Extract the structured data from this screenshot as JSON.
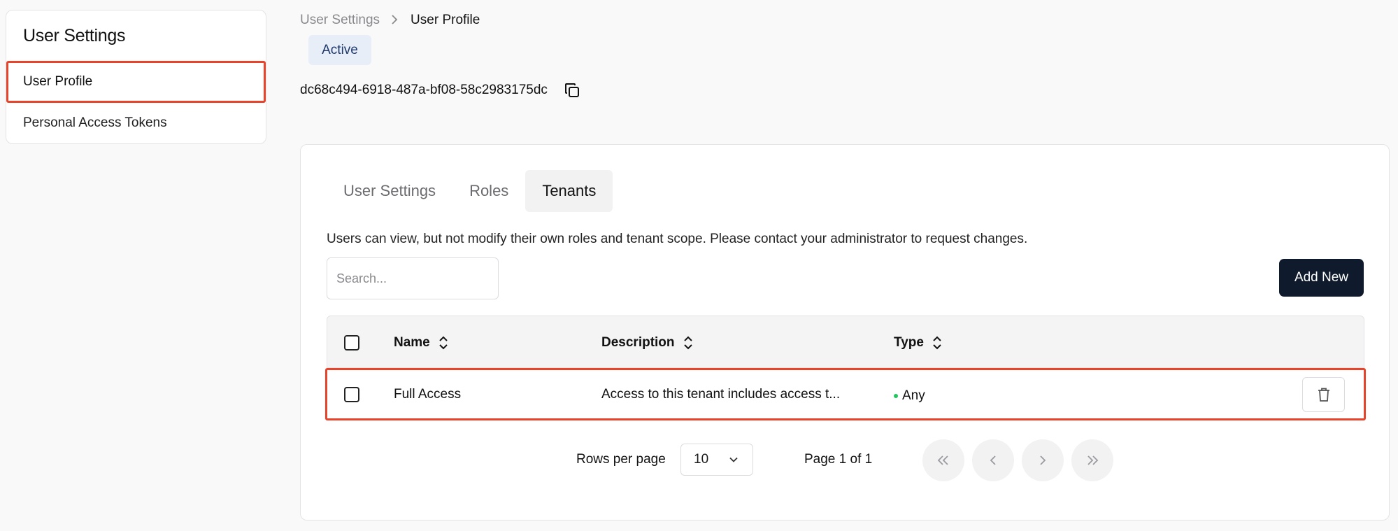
{
  "sidebar": {
    "title": "User Settings",
    "items": [
      {
        "label": "User Profile",
        "selected": true
      },
      {
        "label": "Personal Access Tokens",
        "selected": false
      }
    ]
  },
  "breadcrumb": {
    "parent": "User Settings",
    "current": "User Profile"
  },
  "user": {
    "status": "Active",
    "id": "dc68c494-6918-487a-bf08-58c2983175dc"
  },
  "tabs": [
    {
      "label": "User Settings",
      "active": false
    },
    {
      "label": "Roles",
      "active": false
    },
    {
      "label": "Tenants",
      "active": true
    }
  ],
  "tenants": {
    "info": "Users can view, but not modify their own roles and tenant scope. Please contact your administrator to request changes.",
    "search_placeholder": "Search...",
    "add_new_label": "Add New",
    "columns": [
      "Name",
      "Description",
      "Type"
    ],
    "rows": [
      {
        "name": "Full Access",
        "description": "Access to this tenant includes access t...",
        "type": "Any",
        "type_dot_color": "#22c55e"
      }
    ]
  },
  "pagination": {
    "rows_per_page_label": "Rows per page",
    "rows_per_page_value": "10",
    "page_info": "Page 1 of 1"
  },
  "colors": {
    "highlight": "#e8432b",
    "primary_button": "#0f1b2c",
    "badge_bg": "#e8eef8"
  }
}
